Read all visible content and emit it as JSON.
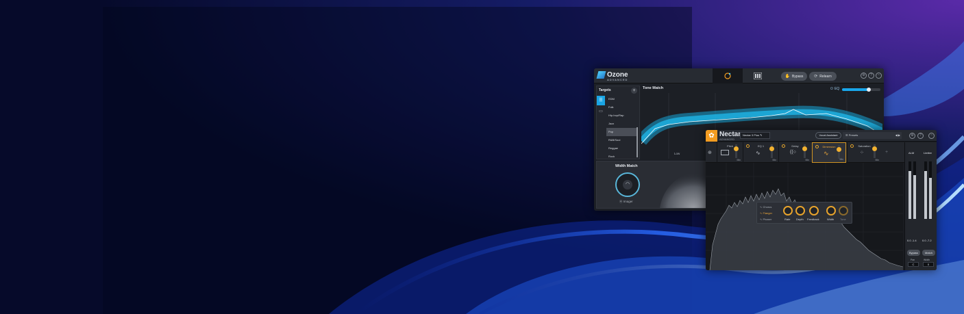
{
  "ozone": {
    "logo": "Ozone",
    "logo_sub": "ADVANCED",
    "bypass": "Bypass",
    "relearn": "Relearn",
    "targets": {
      "title": "Targets",
      "items": [
        "EDM",
        "Folk",
        "Hip-hop/Rap",
        "Jazz",
        "Pop",
        "R&B/Soul",
        "Reggae",
        "Rock"
      ],
      "selected": "Pop"
    },
    "tone_match": {
      "title": "Tone Match",
      "eq_label": "EQ",
      "eq_amount": 0.7,
      "low_label": "Low"
    },
    "width_match": {
      "title": "Width Match",
      "imager_label": "Imager"
    }
  },
  "nectar": {
    "logo": "Nectar",
    "logo_sub": "ADVANCED",
    "preset": "Nectar 3 Plus",
    "vocal_assistant": "Vocal Assistant",
    "presets": "Presets",
    "modules": [
      {
        "name": "Pitch",
        "mix": "Mix"
      },
      {
        "name": "EQ 1",
        "mix": "Mix"
      },
      {
        "name": "Delay",
        "mix": "Mix"
      },
      {
        "name": "Dimension",
        "mix": "Mix"
      },
      {
        "name": "Saturation",
        "mix": "Mix"
      }
    ],
    "dimension": {
      "modes": [
        "Chorus",
        "Flanger",
        "Phaser"
      ],
      "selected_mode": "Flanger",
      "knobs": [
        "Rate",
        "Depth",
        "Feedback",
        "Width",
        "Tone"
      ]
    },
    "meters": {
      "left_label": "ALM",
      "right_label": "Limiter",
      "left_values": "0.0 -1.4",
      "right_values": "0.0 -7.2",
      "bypass": "Bypass",
      "match": "Match",
      "pan_label": "Pan",
      "pan_value": "C",
      "width_label": "Width",
      "width_value": "0"
    },
    "colors": {
      "accent": "#f0a93a",
      "ozone_accent": "#19a6ea"
    }
  }
}
